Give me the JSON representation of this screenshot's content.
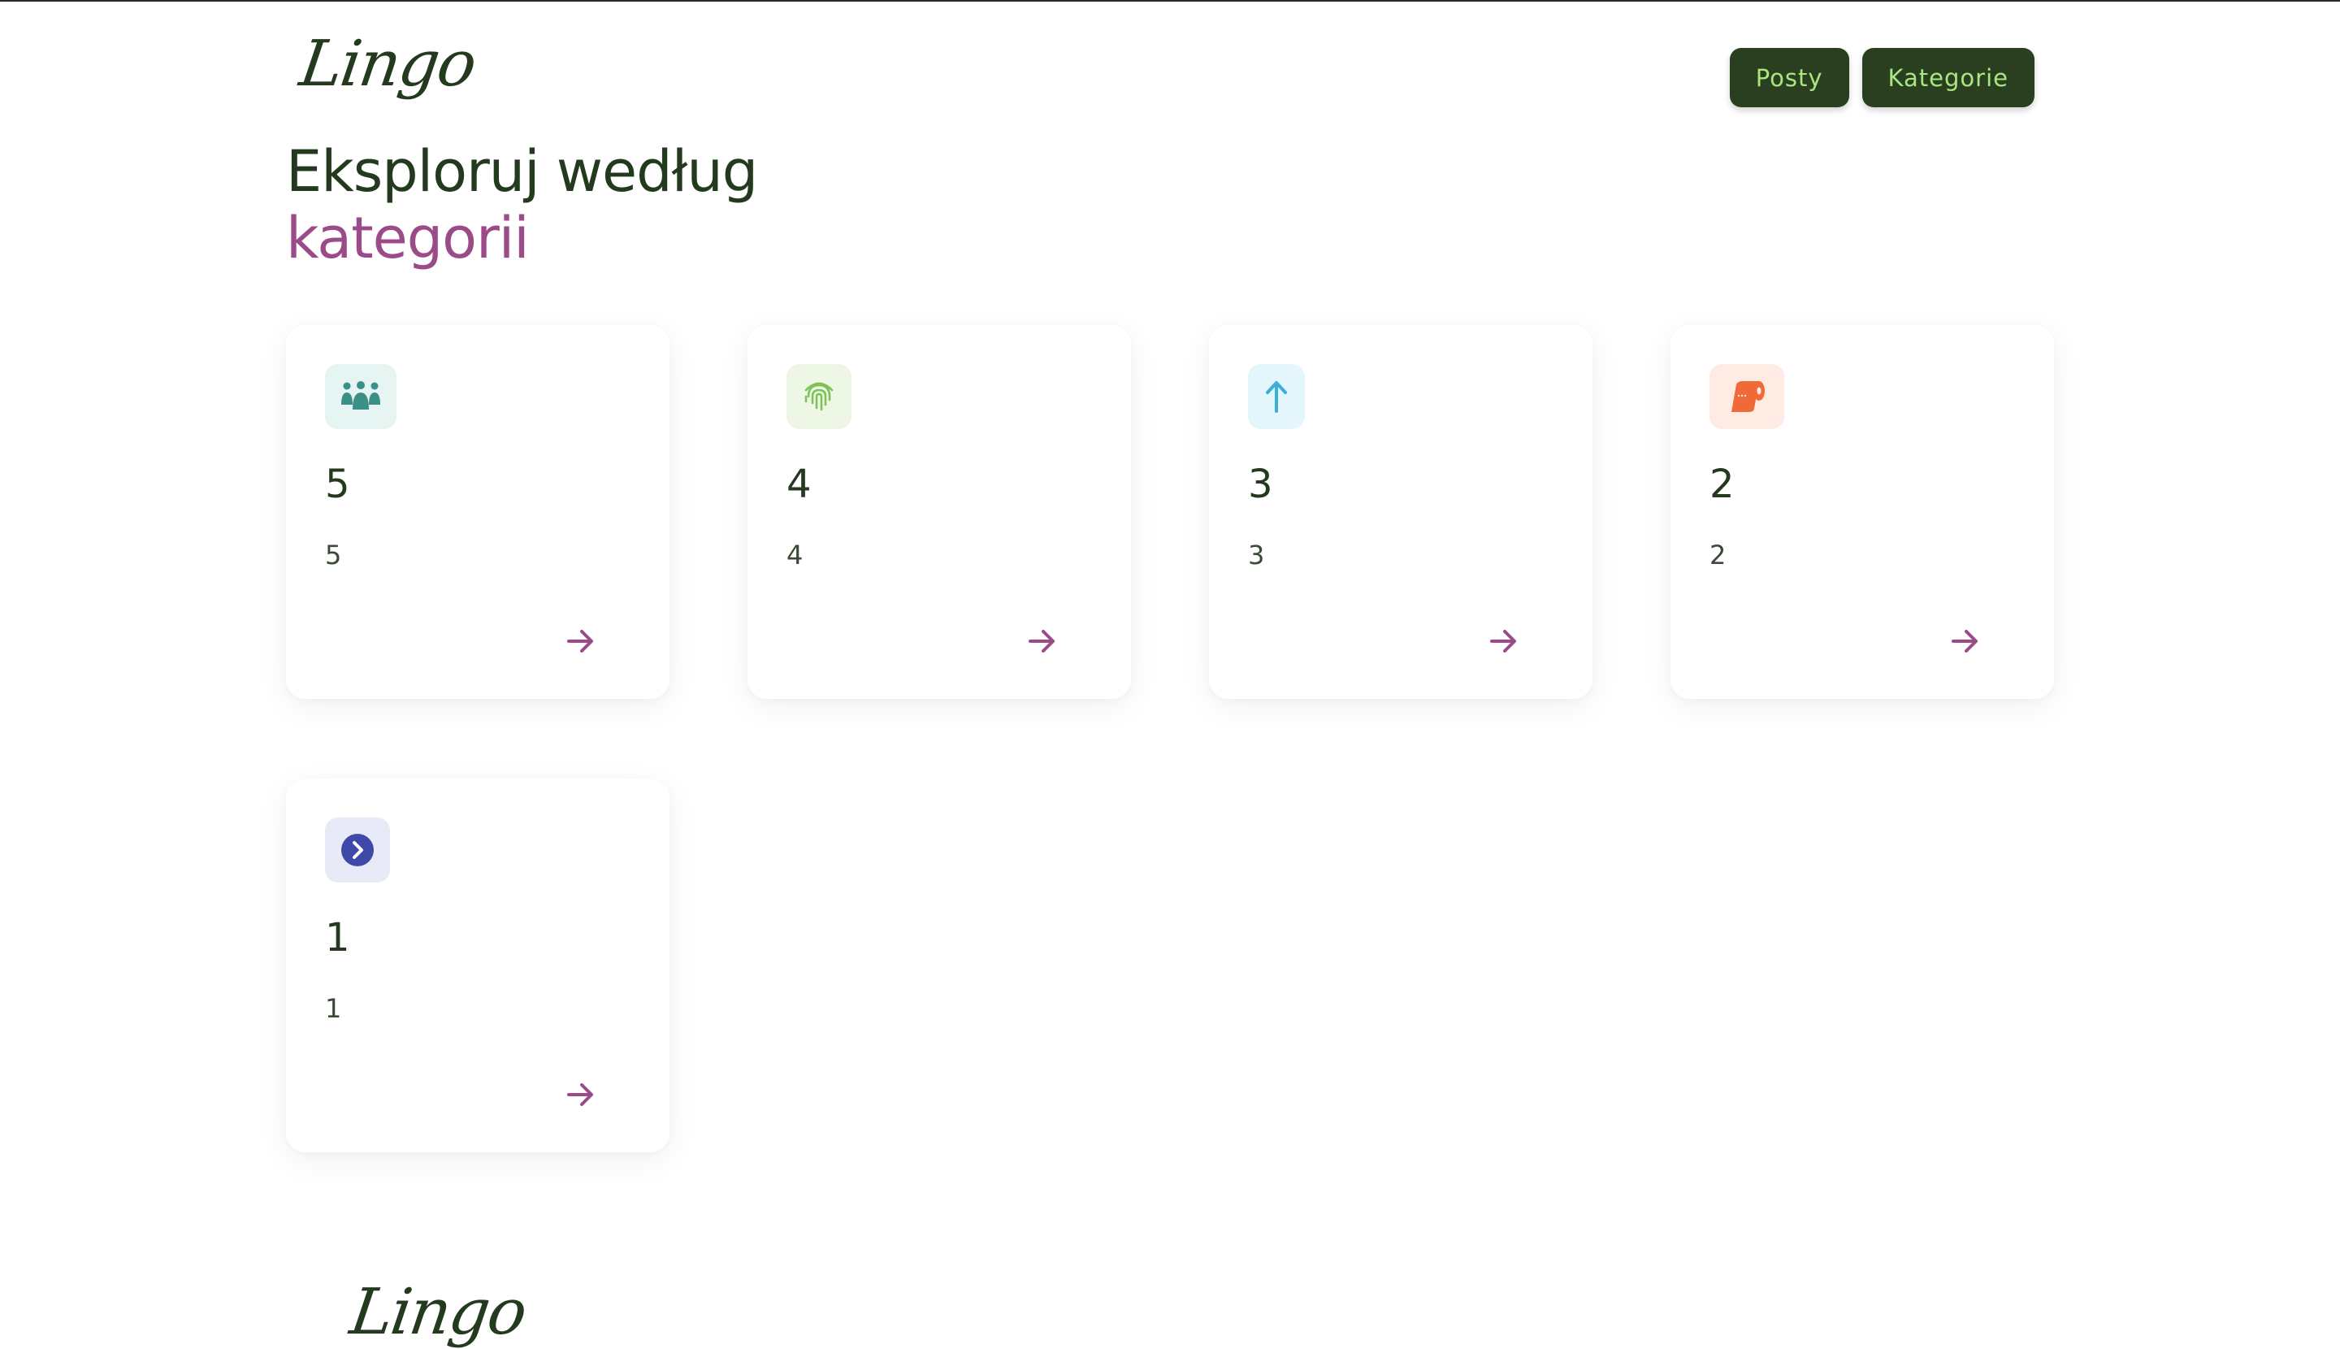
{
  "header": {
    "logo": "Lingo",
    "nav": [
      {
        "label": "Posty"
      },
      {
        "label": "Kategorie"
      }
    ]
  },
  "main": {
    "heading_line1": "Eksploruj według",
    "heading_line2": "kategorii",
    "categories": [
      {
        "title": "5",
        "description": "5",
        "icon": "people-group-icon",
        "icon_color": "#3a8f87",
        "icon_bg": "#e6f4f2"
      },
      {
        "title": "4",
        "description": "4",
        "icon": "fingerprint-icon",
        "icon_color": "#7cc257",
        "icon_bg": "#eef7e6"
      },
      {
        "title": "3",
        "description": "3",
        "icon": "arrow-up-icon",
        "icon_color": "#3bb0d6",
        "icon_bg": "#e4f5fb"
      },
      {
        "title": "2",
        "description": "2",
        "icon": "toilet-paper-icon",
        "icon_color": "#f06a37",
        "icon_bg": "#fdebe4"
      },
      {
        "title": "1",
        "description": "1",
        "icon": "circle-chevron-right-icon",
        "icon_color": "#3f4aa8",
        "icon_bg": "#e9eaf7"
      }
    ]
  },
  "footer": {
    "logo": "Lingo"
  },
  "colors": {
    "brand_dark": "#243a1f",
    "button_bg": "#2a3f20",
    "button_text": "#a9e67f",
    "accent": "#9b4b87"
  }
}
